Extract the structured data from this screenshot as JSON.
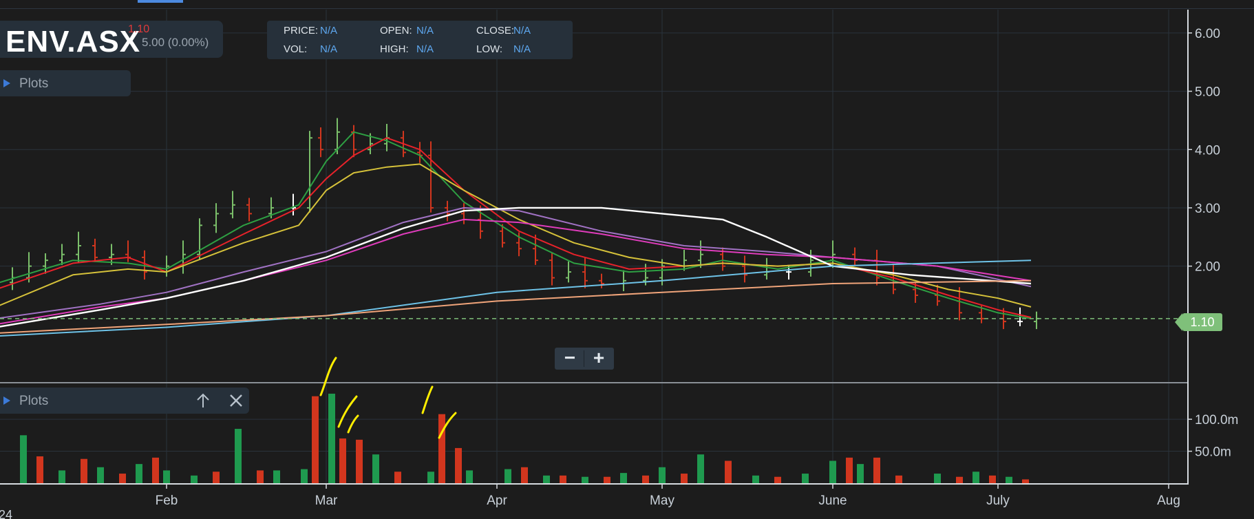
{
  "toolbar": {
    "symbol": "ENV.ASX",
    "last_price": "1.10",
    "change": "5.00 (0.00%)"
  },
  "ohlc": {
    "price_label": "PRICE:",
    "price_value": "N/A",
    "open_label": "OPEN:",
    "open_value": "N/A",
    "close_label": "CLOSE:",
    "close_value": "N/A",
    "vol_label": "VOL:",
    "vol_value": "N/A",
    "high_label": "HIGH:",
    "high_value": "N/A",
    "low_label": "LOW:",
    "low_value": "N/A"
  },
  "panels": {
    "price_plots_label": "Plots",
    "volume_plots_label": "Plots",
    "zoom_out_label": "−",
    "zoom_in_label": "+",
    "move_up_icon": "arrow-up-icon",
    "close_icon": "close-icon"
  },
  "price_tag": "1.10",
  "partial_year_label": "24",
  "colors": {
    "up": "#1f9a4f",
    "down": "#d2361e",
    "ema_green": "#2ea043",
    "ema_red": "#e8222a",
    "ema_yellow": "#d6c23a",
    "ma_purple": "#a172c4",
    "ma_pink": "#e03cbc",
    "ma_white": "#ffffff",
    "ma_cyan": "#6ec3e8",
    "ma_orange": "#f0a47a",
    "last_line": "#7fc07a",
    "annotation": "#ffee00"
  },
  "chart_data": [
    {
      "type": "line",
      "subtype": "ohlc-bars-with-moving-averages",
      "title": "",
      "x_axis_type": "date",
      "x_tick_labels": [
        "Feb",
        "Mar",
        "Apr",
        "May",
        "June",
        "July",
        "Aug"
      ],
      "x_tick_dates": [
        "2024-02-01",
        "2024-03-01",
        "2024-04-01",
        "2024-05-01",
        "2024-06-01",
        "2024-07-01",
        "2024-08-01"
      ],
      "xlim": [
        "2024-01-01",
        "2024-08-01"
      ],
      "ylim": [
        0.0,
        6.4
      ],
      "y_ticks": [
        2.0,
        3.0,
        4.0,
        5.0,
        6.0
      ],
      "y_tick_labels": [
        "2.00",
        "3.00",
        "4.00",
        "5.00",
        "6.00"
      ],
      "last_value": 1.1,
      "grid": true,
      "price_bars": [
        [
          "2024-01-01",
          1.72
        ],
        [
          "2024-01-04",
          1.8
        ],
        [
          "2024-01-07",
          2.0
        ],
        [
          "2024-01-10",
          2.1
        ],
        [
          "2024-01-13",
          2.2
        ],
        [
          "2024-01-16",
          2.35
        ],
        [
          "2024-01-19",
          2.15
        ],
        [
          "2024-01-22",
          2.2
        ],
        [
          "2024-01-25",
          2.15
        ],
        [
          "2024-01-28",
          1.9
        ],
        [
          "2024-02-01",
          2.0
        ],
        [
          "2024-02-04",
          2.2
        ],
        [
          "2024-02-07",
          2.7
        ],
        [
          "2024-02-10",
          2.9
        ],
        [
          "2024-02-13",
          3.05
        ],
        [
          "2024-02-16",
          2.9
        ],
        [
          "2024-02-20",
          3.0
        ],
        [
          "2024-02-24",
          3.0
        ],
        [
          "2024-02-27",
          4.2
        ],
        [
          "2024-02-29",
          4.0
        ],
        [
          "2024-03-03",
          4.3
        ],
        [
          "2024-03-06",
          4.0
        ],
        [
          "2024-03-09",
          4.1
        ],
        [
          "2024-03-12",
          4.2
        ],
        [
          "2024-03-15",
          3.95
        ],
        [
          "2024-03-18",
          3.9
        ],
        [
          "2024-03-20",
          3.0
        ],
        [
          "2024-03-23",
          2.9
        ],
        [
          "2024-03-26",
          2.8
        ],
        [
          "2024-03-29",
          2.6
        ],
        [
          "2024-04-02",
          2.4
        ],
        [
          "2024-04-05",
          2.3
        ],
        [
          "2024-04-08",
          2.1
        ],
        [
          "2024-04-11",
          1.8
        ],
        [
          "2024-04-14",
          1.9
        ],
        [
          "2024-04-17",
          1.75
        ],
        [
          "2024-04-20",
          1.7
        ],
        [
          "2024-04-24",
          1.75
        ],
        [
          "2024-04-28",
          1.8
        ],
        [
          "2024-05-01",
          2.0
        ],
        [
          "2024-05-05",
          2.1
        ],
        [
          "2024-05-08",
          2.2
        ],
        [
          "2024-05-12",
          2.0
        ],
        [
          "2024-05-16",
          1.85
        ],
        [
          "2024-05-20",
          1.9
        ],
        [
          "2024-05-24",
          1.9
        ],
        [
          "2024-05-28",
          2.1
        ],
        [
          "2024-06-01",
          2.2
        ],
        [
          "2024-06-05",
          2.1
        ],
        [
          "2024-06-09",
          1.8
        ],
        [
          "2024-06-12",
          1.6
        ],
        [
          "2024-06-16",
          1.5
        ],
        [
          "2024-06-20",
          1.4
        ],
        [
          "2024-06-24",
          1.2
        ],
        [
          "2024-06-28",
          1.1
        ],
        [
          "2024-07-02",
          1.05
        ],
        [
          "2024-07-05",
          1.05
        ],
        [
          "2024-07-08",
          1.1
        ]
      ],
      "series": [
        {
          "color": "green",
          "points": [
            [
              "2024-01-01",
              1.7
            ],
            [
              "2024-01-15",
              2.1
            ],
            [
              "2024-01-25",
              2.05
            ],
            [
              "2024-02-01",
              1.95
            ],
            [
              "2024-02-15",
              2.7
            ],
            [
              "2024-02-25",
              3.05
            ],
            [
              "2024-03-01",
              3.8
            ],
            [
              "2024-03-06",
              4.3
            ],
            [
              "2024-03-12",
              4.15
            ],
            [
              "2024-03-18",
              3.9
            ],
            [
              "2024-03-26",
              3.1
            ],
            [
              "2024-04-05",
              2.5
            ],
            [
              "2024-04-15",
              2.05
            ],
            [
              "2024-04-25",
              1.9
            ],
            [
              "2024-05-05",
              1.95
            ],
            [
              "2024-05-12",
              2.1
            ],
            [
              "2024-05-22",
              1.95
            ],
            [
              "2024-06-01",
              2.1
            ],
            [
              "2024-06-12",
              1.75
            ],
            [
              "2024-06-22",
              1.45
            ],
            [
              "2024-07-01",
              1.2
            ],
            [
              "2024-07-07",
              1.1
            ]
          ]
        },
        {
          "color": "red",
          "points": [
            [
              "2024-01-01",
              1.6
            ],
            [
              "2024-01-15",
              2.05
            ],
            [
              "2024-01-25",
              2.15
            ],
            [
              "2024-02-01",
              1.9
            ],
            [
              "2024-02-15",
              2.55
            ],
            [
              "2024-02-25",
              3.0
            ],
            [
              "2024-03-01",
              3.5
            ],
            [
              "2024-03-06",
              3.9
            ],
            [
              "2024-03-12",
              4.2
            ],
            [
              "2024-03-18",
              4.0
            ],
            [
              "2024-03-26",
              3.3
            ],
            [
              "2024-04-05",
              2.6
            ],
            [
              "2024-04-15",
              2.2
            ],
            [
              "2024-04-25",
              1.95
            ],
            [
              "2024-05-05",
              2.0
            ],
            [
              "2024-05-12",
              2.05
            ],
            [
              "2024-05-22",
              2.0
            ],
            [
              "2024-06-01",
              2.05
            ],
            [
              "2024-06-12",
              1.8
            ],
            [
              "2024-06-22",
              1.5
            ],
            [
              "2024-07-01",
              1.25
            ],
            [
              "2024-07-07",
              1.12
            ]
          ]
        },
        {
          "color": "yellow",
          "points": [
            [
              "2024-01-01",
              1.3
            ],
            [
              "2024-01-15",
              1.85
            ],
            [
              "2024-01-25",
              1.95
            ],
            [
              "2024-02-01",
              1.9
            ],
            [
              "2024-02-15",
              2.4
            ],
            [
              "2024-02-25",
              2.7
            ],
            [
              "2024-03-01",
              3.3
            ],
            [
              "2024-03-06",
              3.6
            ],
            [
              "2024-03-12",
              3.7
            ],
            [
              "2024-03-18",
              3.75
            ],
            [
              "2024-03-26",
              3.3
            ],
            [
              "2024-04-05",
              2.8
            ],
            [
              "2024-04-15",
              2.4
            ],
            [
              "2024-04-25",
              2.15
            ],
            [
              "2024-05-05",
              2.0
            ],
            [
              "2024-05-12",
              2.05
            ],
            [
              "2024-05-22",
              2.0
            ],
            [
              "2024-06-01",
              2.05
            ],
            [
              "2024-06-12",
              1.85
            ],
            [
              "2024-06-22",
              1.6
            ],
            [
              "2024-07-01",
              1.45
            ],
            [
              "2024-07-07",
              1.3
            ]
          ]
        },
        {
          "color": "purple",
          "points": [
            [
              "2024-01-01",
              1.1
            ],
            [
              "2024-01-20",
              1.35
            ],
            [
              "2024-02-01",
              1.55
            ],
            [
              "2024-02-15",
              1.9
            ],
            [
              "2024-03-01",
              2.25
            ],
            [
              "2024-03-15",
              2.75
            ],
            [
              "2024-03-26",
              3.0
            ],
            [
              "2024-04-05",
              2.95
            ],
            [
              "2024-04-20",
              2.6
            ],
            [
              "2024-05-05",
              2.35
            ],
            [
              "2024-05-20",
              2.25
            ],
            [
              "2024-06-01",
              2.15
            ],
            [
              "2024-06-20",
              2.0
            ],
            [
              "2024-07-07",
              1.65
            ]
          ]
        },
        {
          "color": "pink",
          "points": [
            [
              "2024-01-01",
              1.0
            ],
            [
              "2024-01-20",
              1.3
            ],
            [
              "2024-02-01",
              1.45
            ],
            [
              "2024-02-15",
              1.75
            ],
            [
              "2024-03-01",
              2.1
            ],
            [
              "2024-03-15",
              2.55
            ],
            [
              "2024-03-26",
              2.8
            ],
            [
              "2024-04-05",
              2.75
            ],
            [
              "2024-04-20",
              2.55
            ],
            [
              "2024-05-05",
              2.3
            ],
            [
              "2024-05-20",
              2.2
            ],
            [
              "2024-06-01",
              2.15
            ],
            [
              "2024-06-20",
              2.0
            ],
            [
              "2024-07-07",
              1.75
            ]
          ]
        },
        {
          "color": "white",
          "points": [
            [
              "2024-01-01",
              0.95
            ],
            [
              "2024-01-20",
              1.25
            ],
            [
              "2024-02-01",
              1.45
            ],
            [
              "2024-02-15",
              1.75
            ],
            [
              "2024-03-01",
              2.15
            ],
            [
              "2024-03-15",
              2.65
            ],
            [
              "2024-03-26",
              2.95
            ],
            [
              "2024-04-05",
              3.0
            ],
            [
              "2024-04-20",
              3.0
            ],
            [
              "2024-05-01",
              2.9
            ],
            [
              "2024-05-12",
              2.8
            ],
            [
              "2024-05-20",
              2.5
            ],
            [
              "2024-06-01",
              2.0
            ],
            [
              "2024-06-15",
              1.85
            ],
            [
              "2024-07-07",
              1.7
            ]
          ]
        },
        {
          "color": "cyan",
          "points": [
            [
              "2024-01-01",
              0.8
            ],
            [
              "2024-02-01",
              0.95
            ],
            [
              "2024-03-01",
              1.15
            ],
            [
              "2024-04-01",
              1.55
            ],
            [
              "2024-05-01",
              1.75
            ],
            [
              "2024-06-01",
              2.0
            ],
            [
              "2024-07-07",
              2.1
            ]
          ]
        },
        {
          "color": "orange",
          "points": [
            [
              "2024-01-01",
              0.85
            ],
            [
              "2024-02-01",
              1.0
            ],
            [
              "2024-03-01",
              1.15
            ],
            [
              "2024-04-01",
              1.4
            ],
            [
              "2024-05-01",
              1.55
            ],
            [
              "2024-06-01",
              1.7
            ],
            [
              "2024-07-07",
              1.75
            ]
          ]
        }
      ]
    },
    {
      "type": "bar",
      "title": "",
      "x_axis_type": "date",
      "ylim": [
        0,
        155
      ],
      "y_ticks": [
        50,
        100
      ],
      "y_tick_labels": [
        "50.0m",
        "100.0m"
      ],
      "y_unit": "m",
      "series": [
        {
          "color": "up",
          "x": [
            "2024-01-01",
            "2024-01-06",
            "2024-01-13",
            "2024-01-20",
            "2024-01-27",
            "2024-02-01",
            "2024-02-06",
            "2024-02-14",
            "2024-02-21",
            "2024-02-26",
            "2024-03-02",
            "2024-03-10",
            "2024-03-20",
            "2024-03-27",
            "2024-04-03",
            "2024-04-10",
            "2024-04-17",
            "2024-04-24",
            "2024-05-01",
            "2024-05-08",
            "2024-05-18",
            "2024-05-27",
            "2024-06-01",
            "2024-06-06",
            "2024-06-20",
            "2024-06-27",
            "2024-07-03"
          ],
          "values": [
            60,
            75,
            20,
            25,
            30,
            20,
            12,
            85,
            20,
            22,
            140,
            45,
            18,
            20,
            22,
            12,
            10,
            16,
            25,
            45,
            12,
            15,
            35,
            30,
            15,
            18,
            10
          ]
        },
        {
          "color": "down",
          "x": [
            "2024-01-09",
            "2024-01-17",
            "2024-01-24",
            "2024-01-30",
            "2024-02-10",
            "2024-02-18",
            "2024-02-28",
            "2024-03-04",
            "2024-03-07",
            "2024-03-14",
            "2024-03-22",
            "2024-03-25",
            "2024-04-06",
            "2024-04-13",
            "2024-04-21",
            "2024-04-28",
            "2024-05-05",
            "2024-05-13",
            "2024-05-22",
            "2024-06-04",
            "2024-06-09",
            "2024-06-13",
            "2024-06-24",
            "2024-06-30",
            "2024-07-06"
          ],
          "values": [
            42,
            38,
            15,
            40,
            18,
            20,
            136,
            70,
            68,
            18,
            108,
            55,
            25,
            12,
            10,
            12,
            15,
            35,
            10,
            40,
            40,
            12,
            10,
            12,
            6
          ]
        }
      ]
    }
  ]
}
